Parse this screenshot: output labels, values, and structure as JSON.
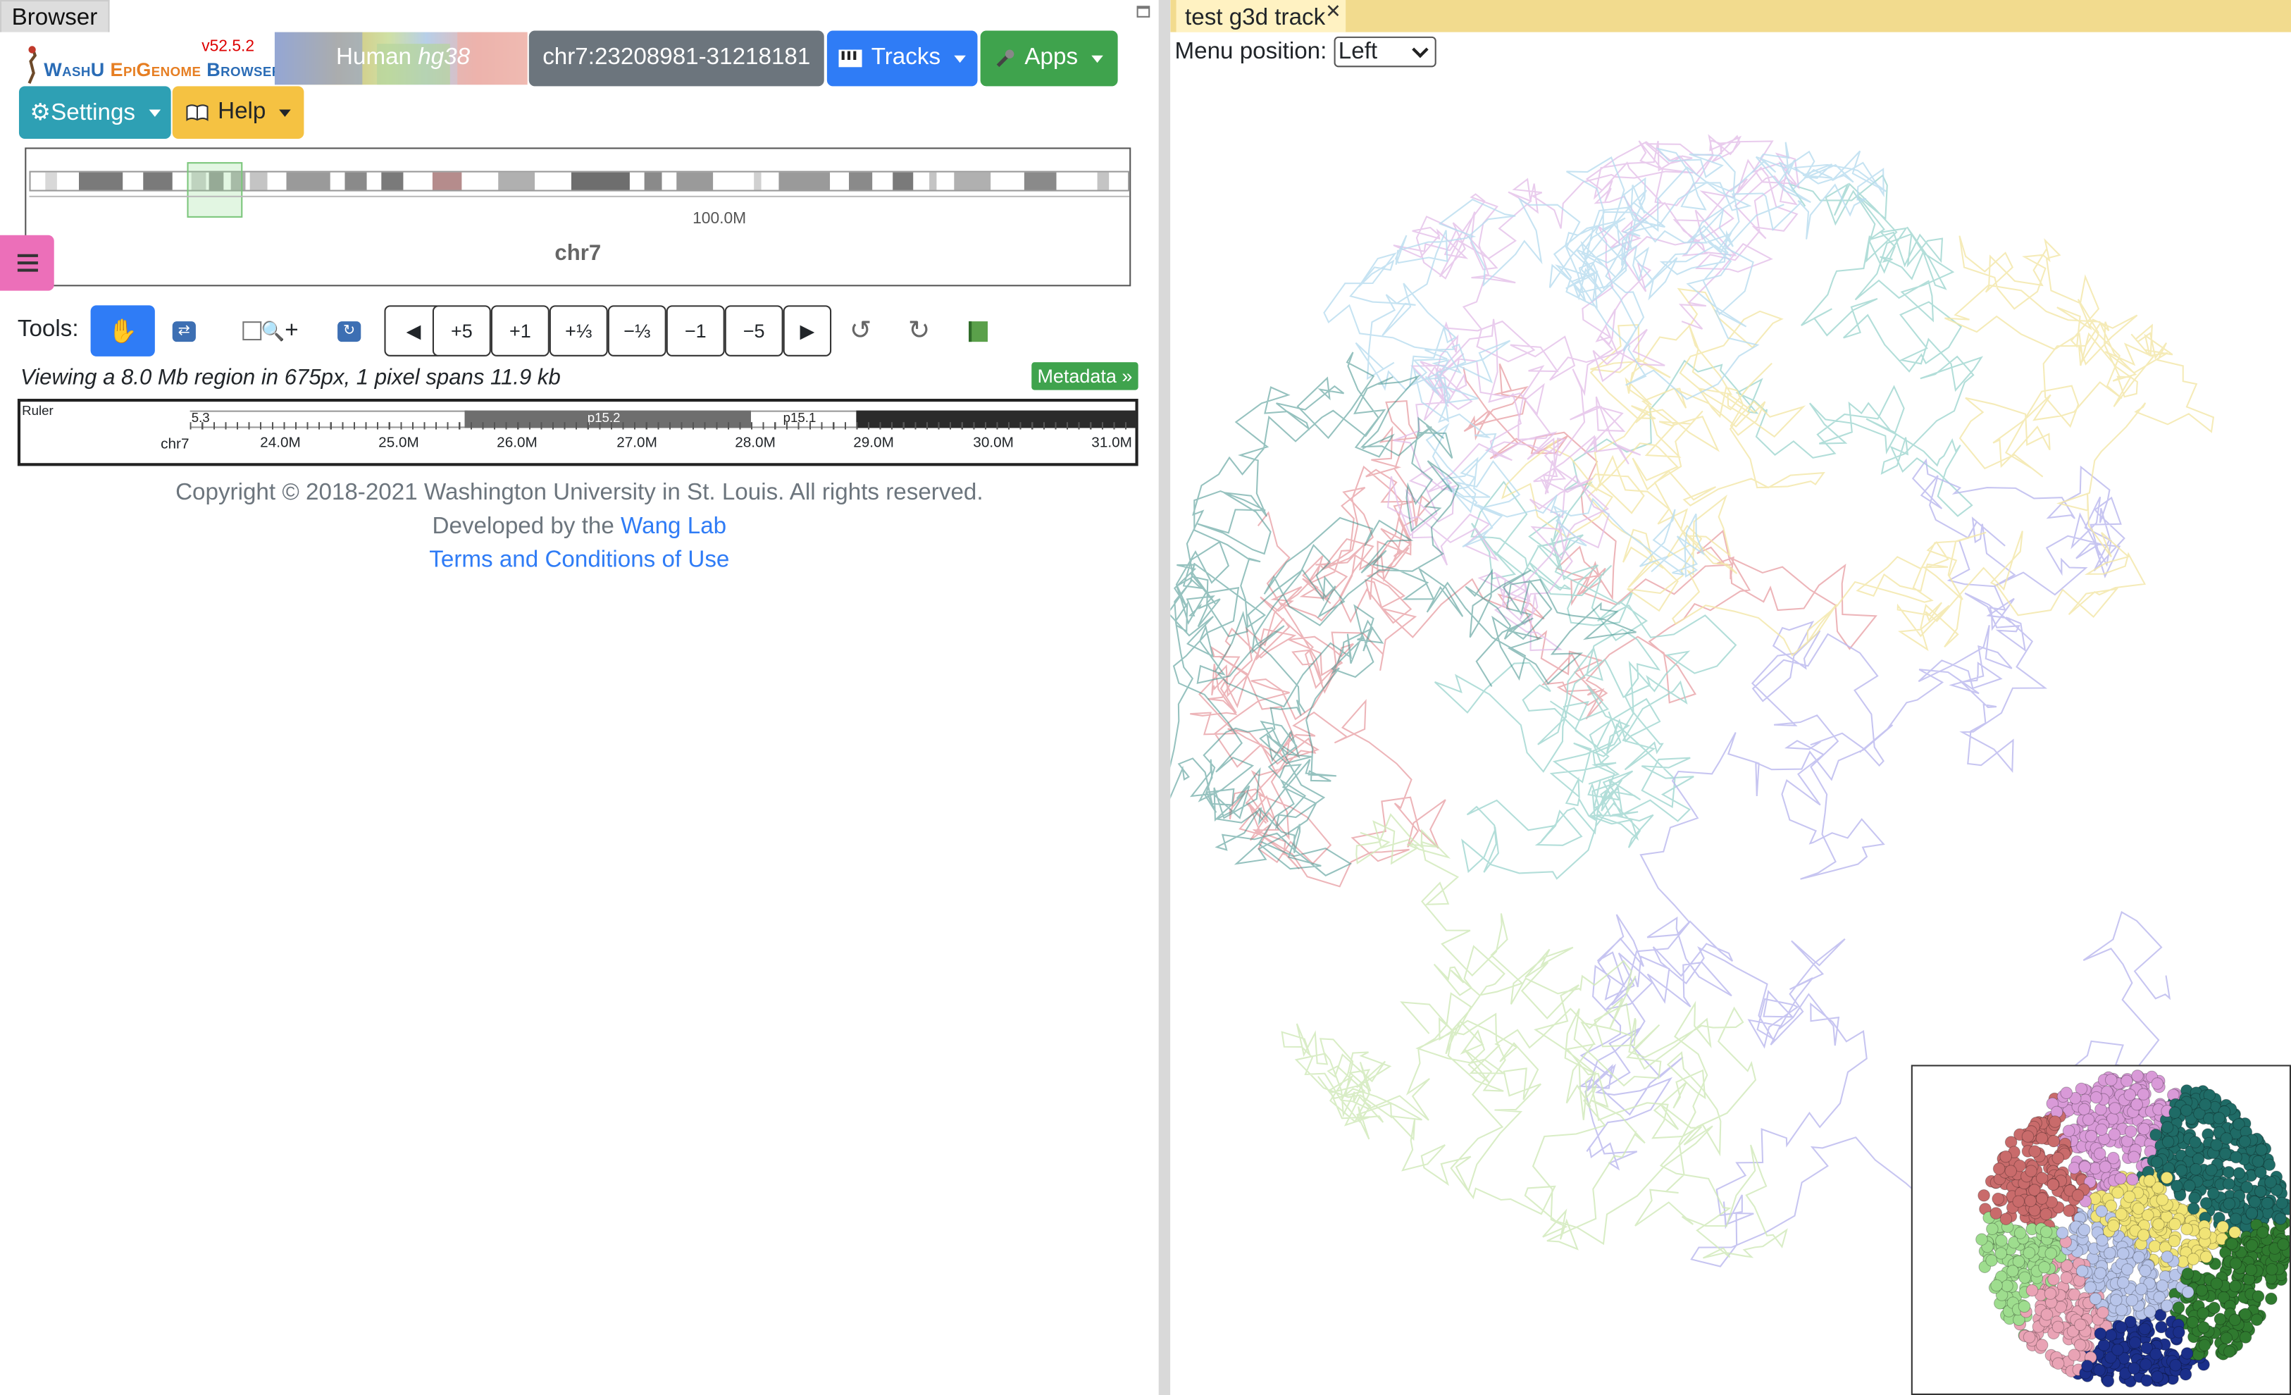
{
  "left": {
    "tab_title": "Browser",
    "logo": {
      "version": "v52.5.2",
      "title_part1": "WashU ",
      "title_part2": "EpiGenome",
      "title_part3": " Browser"
    },
    "genome": {
      "species": "Human",
      "assembly": "hg38"
    },
    "region": "chr7:23208981-31218181",
    "buttons": {
      "tracks": "Tracks",
      "apps": "Apps",
      "settings": "⚙Settings",
      "help": "Help"
    },
    "chromosome": {
      "name": "chr7",
      "tick_label": "100.0M"
    },
    "tools": {
      "label": "Tools:",
      "nav": [
        "◀",
        "+5",
        "+1",
        "+⅓",
        "−⅓",
        "−1",
        "−5",
        "▶"
      ],
      "zoom_plus": "+"
    },
    "viewing_text": "Viewing a 8.0 Mb region in 675px, 1 pixel spans 11.9 kb",
    "metadata_button": "Metadata »",
    "ruler": {
      "label": "Ruler",
      "chrom": "chr7",
      "band_labels": [
        "5.3",
        "p15.2",
        "p15.1"
      ],
      "ticks": [
        "24.0M",
        "25.0M",
        "26.0M",
        "27.0M",
        "28.0M",
        "29.0M",
        "30.0M",
        "31.0M"
      ]
    },
    "footer": {
      "copyright": "Copyright © 2018-2021 Washington University in St. Louis. All rights reserved.",
      "developed_prefix": "Developed by the ",
      "lab_link": "Wang Lab",
      "terms_link": "Terms and Conditions of Use"
    }
  },
  "right": {
    "tab_title": "test g3d track",
    "close_glyph": "✕",
    "menu_position_label": "Menu position:",
    "menu_position_value": "Left",
    "cluster_colors": [
      "#e8a3a8",
      "#9fd6d0",
      "#b9b6ee",
      "#cfe8b8",
      "#f3e6a6",
      "#e3bfe8",
      "#b8dcef",
      "#3f8f8a"
    ],
    "inset_colors": [
      "#c96b6b",
      "#d99ad8",
      "#f1e476",
      "#1f6b66",
      "#9edd8e",
      "#b8c5ea",
      "#e9a3b5",
      "#1b2f8a",
      "#2f7a2f"
    ]
  },
  "colors": {
    "primary": "#2f7cf6",
    "success": "#3fa34d",
    "info": "#2ea0b4",
    "warning": "#f5c242",
    "secondary": "#6c757d",
    "pink": "#ec6fb9"
  }
}
